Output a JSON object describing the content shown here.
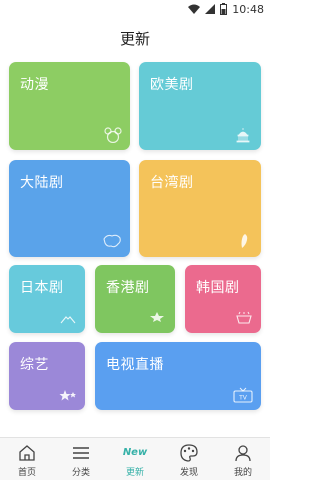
{
  "status_bar": {
    "time": "10:48",
    "battery": "2"
  },
  "header": {
    "title": "更新"
  },
  "categories": [
    {
      "label": "动漫",
      "icon": "bear-icon"
    },
    {
      "label": "欧美剧",
      "icon": "capitol-icon"
    },
    {
      "label": "大陆剧",
      "icon": "china-map-icon"
    },
    {
      "label": "台湾剧",
      "icon": "taiwan-map-icon"
    },
    {
      "label": "日本剧",
      "icon": "mountain-icon"
    },
    {
      "label": "香港剧",
      "icon": "bauhinia-icon"
    },
    {
      "label": "韩国剧",
      "icon": "pot-icon"
    },
    {
      "label": "综艺",
      "icon": "stars-icon"
    },
    {
      "label": "电视直播",
      "icon": "tv-icon"
    }
  ],
  "colors": {
    "dongman": "#8dcd63",
    "oumei": "#65cbd6",
    "dalu": "#5aa3ea",
    "taiwan": "#f4c35a",
    "riben": "#67cadc",
    "xianggang": "#7fc660",
    "hanguo": "#eb6a8e",
    "zongyi": "#9b88d8",
    "dianshi": "#5a9ff0",
    "accent": "#36b1a8"
  },
  "tabbar": {
    "items": [
      {
        "label": "首页",
        "icon": "home-icon"
      },
      {
        "label": "分类",
        "icon": "list-icon"
      },
      {
        "label": "更新",
        "badge": "New",
        "icon": "new-badge-icon"
      },
      {
        "label": "发现",
        "icon": "palette-icon"
      },
      {
        "label": "我的",
        "icon": "person-icon"
      }
    ]
  }
}
